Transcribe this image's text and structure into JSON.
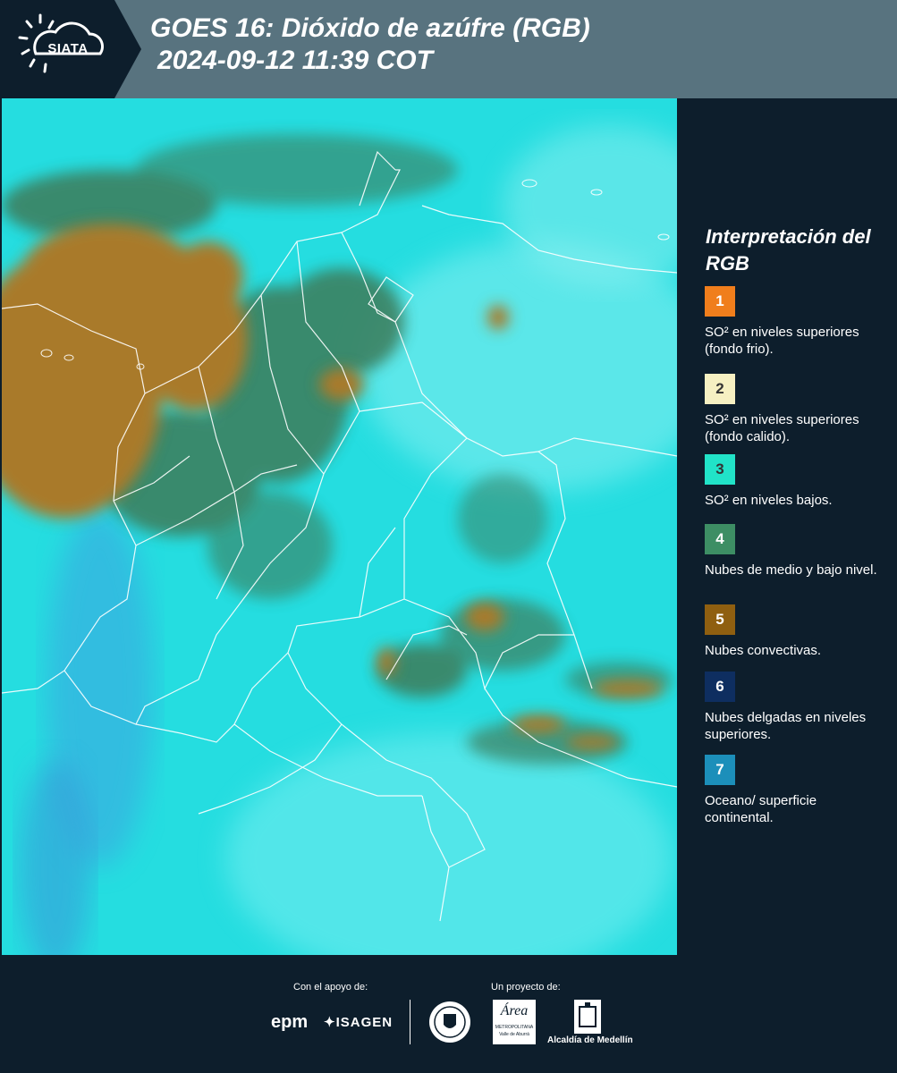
{
  "header": {
    "logo_text": "SIATA",
    "title_line1": "GOES 16: Dióxido de azúfre (RGB)",
    "title_line2": "2024-09-12 11:39 COT"
  },
  "legend": {
    "title": "Interpretación del RGB",
    "items": [
      {
        "number": "1",
        "color": "#f07e1c",
        "text": "SO² en niveles superiores (fondo frio)."
      },
      {
        "number": "2",
        "color": "#f6f0c2",
        "text": "SO² en niveles superiores (fondo calido)."
      },
      {
        "number": "3",
        "color": "#21e3c8",
        "text": "SO² en niveles bajos."
      },
      {
        "number": "4",
        "color": "#3d8e64",
        "text": "Nubes de medio y bajo nivel."
      },
      {
        "number": "5",
        "color": "#8f5f10",
        "text": "Nubes convectivas."
      },
      {
        "number": "6",
        "color": "#0e2e60",
        "text": "Nubes delgadas en niveles superiores."
      },
      {
        "number": "7",
        "color": "#1c8fba",
        "text": "Oceano/ superficie continental."
      }
    ]
  },
  "footer": {
    "support_label": "Con el apoyo de:",
    "project_label": "Un proyecto de:",
    "sponsors": [
      "epm",
      "ISAGEN"
    ],
    "partners": [
      "Área Metropolitana Valle de Aburrá",
      "Alcaldía de Medellín"
    ],
    "area_word": "Área",
    "area_sub1": "METROPOLITANA",
    "area_sub2": "Valle de Aburrá"
  },
  "colors": {
    "header_bg": "#58737f",
    "panel_bg": "#0d1e2c",
    "map_cyan": "#25dde0",
    "map_brown": "#a97a2a",
    "map_green": "#3d8060"
  }
}
